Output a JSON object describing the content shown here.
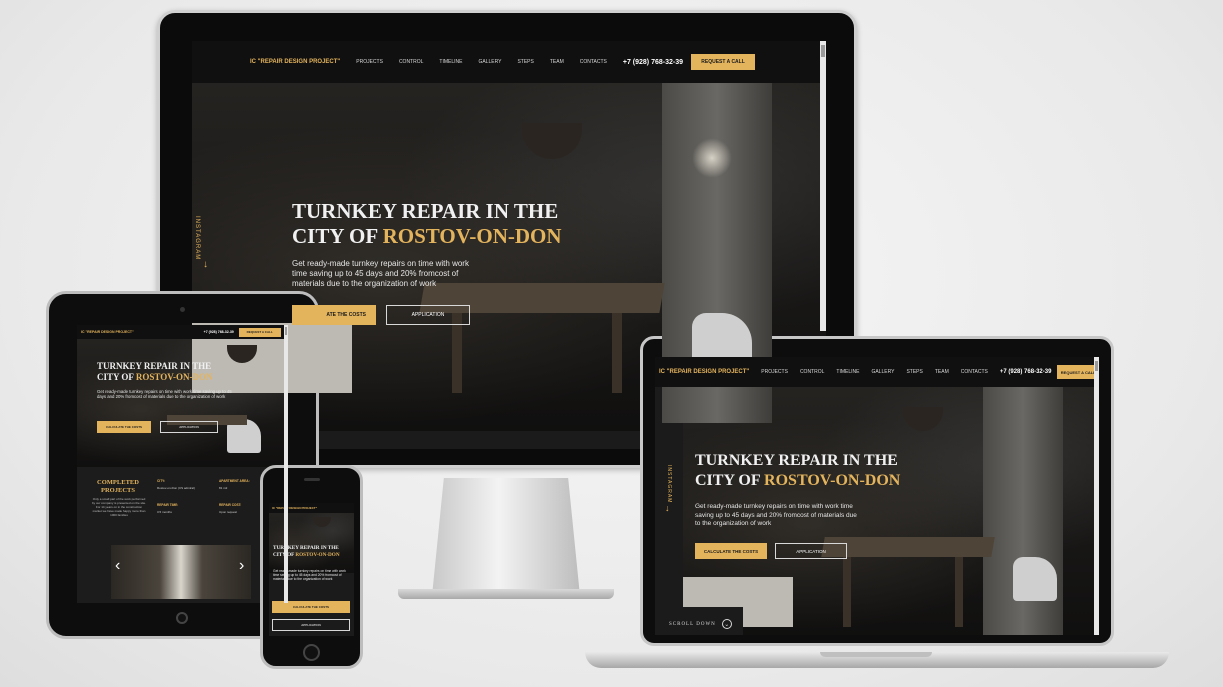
{
  "brand": "IC \"REPAIR DESIGN PROJECT\"",
  "nav": {
    "items": [
      "PROJECTS",
      "CONTROL",
      "TIMELINE",
      "GALLERY",
      "STEPS",
      "TEAM",
      "CONTACTS"
    ],
    "phone": "+7 (928) 768-32-39",
    "request_button": "REQUEST A CALL"
  },
  "hero": {
    "title_line1": "TURNKEY REPAIR IN THE",
    "title_line2_prefix": "CITY OF",
    "title_city": "ROSTOV-ON-DON",
    "subtitle": "Get ready-made turnkey repairs on time with work time saving up to 45 days and 20% fromcost of materials due to the organization of work",
    "calc_button": "CALCULATE THE COSTS",
    "calc_button_cropped": "ATE THE COSTS",
    "application_button": "APPLICATION",
    "instagram": "INSTAGRAM",
    "scroll_down": "SCROLL DOWN"
  },
  "completed": {
    "title": "COMPLETED PROJECTS",
    "description": "Only a small part of the work performed by our company is presented on the site. For 14 years on in the construction market we have made happy more than 1000 families",
    "city_label": "CITY:",
    "city_value": "Rostov-on-Don (CS admiral)",
    "area_label": "APARTMENT AREA:",
    "area_value": "81 m2",
    "time_label": "REPAIR TIME:",
    "time_value": "3.5 months",
    "cost_label": "REPAIR COST:",
    "cost_value": "Upon request"
  },
  "colors": {
    "accent": "#e4b45d",
    "dark": "#1b1b1b",
    "nav_bg": "#101010"
  },
  "icons": {
    "arrow_down": "↓",
    "chevron_left": "‹",
    "chevron_right": "›",
    "chevron_down": "⌄"
  }
}
